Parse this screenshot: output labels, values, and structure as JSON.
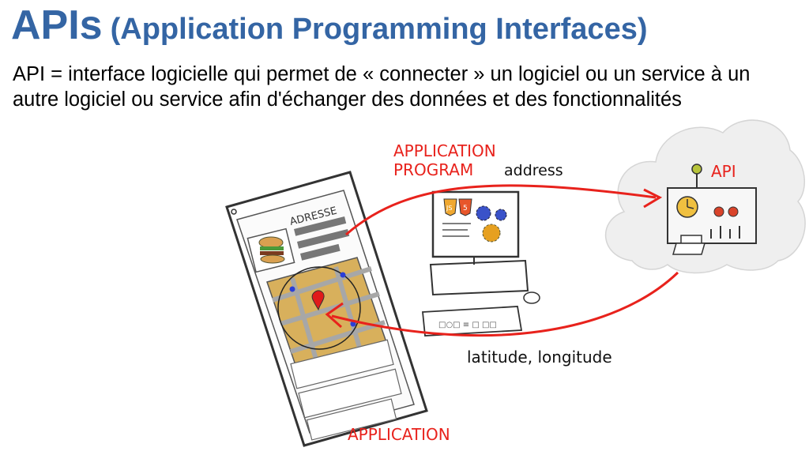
{
  "slide": {
    "title_main": "APIs",
    "title_sub": "(Application Programming Interfaces)",
    "description": "API = interface logicielle qui permet de « connecter » un logiciel ou un service à un autre logiciel ou service afin d'échanger des données et des fonctionnalités"
  },
  "diagram": {
    "label_program_line1": "APPLICATION",
    "label_program_line2": "PROGRAM",
    "label_address": "address",
    "label_api": "API",
    "label_latlong": "latitude, longitude",
    "label_application": "APPLICATION",
    "phone_adresse": "ADRESSE",
    "js_badge": "JS",
    "html_badge": "5"
  },
  "colors": {
    "title": "#3465a4",
    "red_label": "#e8221c",
    "arrow": "#e8221c",
    "map_tan": "#d8b05c",
    "map_road": "#a7a7a7",
    "cloud": "#e9e9e9",
    "gear_blue": "#3a52c9",
    "gear_orange": "#e6a020"
  }
}
